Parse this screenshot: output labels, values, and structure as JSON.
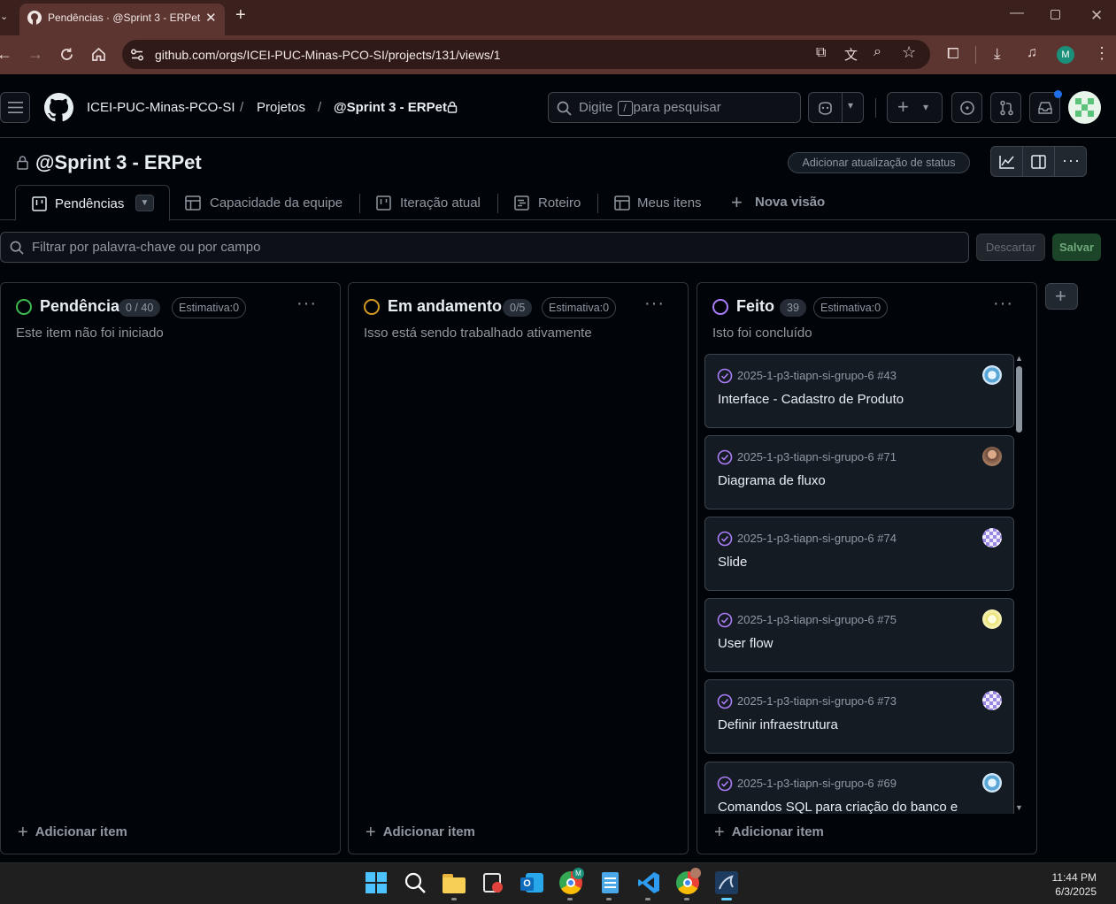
{
  "browser": {
    "tab_title": "Pendências · @Sprint 3 - ERPet",
    "url": "github.com/orgs/ICEI-PUC-Minas-PCO-SI/projects/131/views/1",
    "profile_initial": "M"
  },
  "header": {
    "org": "ICEI-PUC-Minas-PCO-SI",
    "projects": "Projetos",
    "project": "@Sprint 3 - ERPet",
    "search_prefix": "Digite",
    "search_key": "/",
    "search_suffix": "para pesquisar"
  },
  "project": {
    "title": "@Sprint 3 - ERPet",
    "status_button": "Adicionar atualização de status"
  },
  "views": {
    "active": "Pendências",
    "tabs": [
      "Capacidade da equipe",
      "Iteração atual",
      "Roteiro",
      "Meus itens"
    ],
    "new_view": "Nova visão"
  },
  "filter": {
    "placeholder": "Filtrar por palavra-chave ou por campo",
    "discard": "Descartar",
    "save": "Salvar"
  },
  "columns": [
    {
      "title": "Pendência",
      "count": "0 / 40",
      "estimate": "Estimativa:0",
      "description": "Este item não foi iniciado",
      "color": "#3fb950",
      "add_label": "Adicionar item"
    },
    {
      "title": "Em andamento",
      "count": "0/5",
      "estimate": "Estimativa:0",
      "description": "Isso está sendo trabalhado ativamente",
      "color": "#d29922",
      "add_label": "Adicionar item"
    },
    {
      "title": "Feito",
      "count": "39",
      "estimate": "Estimativa:0",
      "description": "Isto foi concluído",
      "color": "#ab7df8",
      "add_label": "Adicionar item",
      "cards": [
        {
          "repo": "2025-1-p3-tiapn-si-grupo-6 #43",
          "title": "Interface - Cadastro de Produto"
        },
        {
          "repo": "2025-1-p3-tiapn-si-grupo-6 #71",
          "title": "Diagrama de fluxo"
        },
        {
          "repo": "2025-1-p3-tiapn-si-grupo-6 #74",
          "title": "Slide"
        },
        {
          "repo": "2025-1-p3-tiapn-si-grupo-6 #75",
          "title": "User flow"
        },
        {
          "repo": "2025-1-p3-tiapn-si-grupo-6 #73",
          "title": "Definir infraestrutura"
        },
        {
          "repo": "2025-1-p3-tiapn-si-grupo-6 #69",
          "title": "Comandos SQL para criação do banco e"
        }
      ]
    }
  ],
  "taskbar": {
    "time": "11:44 PM",
    "date": "6/3/2025"
  },
  "colors": {
    "accent_done": "#ab7df8",
    "accent_todo": "#3fb950",
    "accent_progress": "#d29922",
    "save_button": "#1c4428"
  }
}
